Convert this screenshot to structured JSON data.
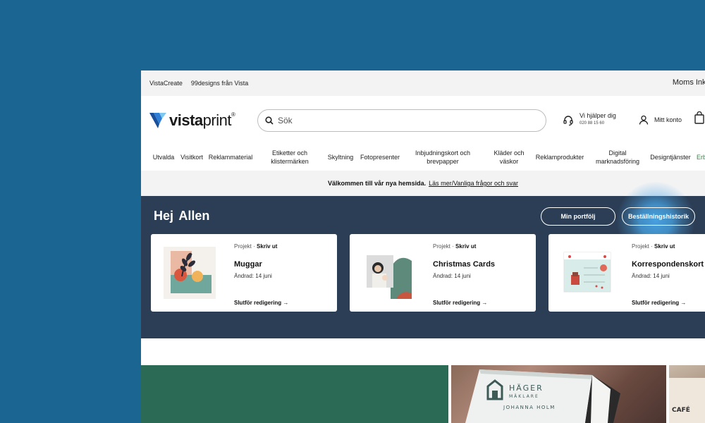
{
  "topbar": {
    "links": [
      "VistaCreate",
      "99designs från Vista"
    ],
    "right_text": "Moms Inkl"
  },
  "header": {
    "logo_text_a": "vista",
    "logo_text_b": "print",
    "logo_mark": "®",
    "search_placeholder": "Sök",
    "help_title": "Vi hjälper dig",
    "help_phone": "020 88 15 60",
    "account_label": "Mitt konto"
  },
  "nav": {
    "items": [
      "Utvalda",
      "Visitkort",
      "Reklammaterial",
      "Etiketter och klistermärken",
      "Skyltning",
      "Fotopresenter",
      "Inbjudningskort och brevpapper",
      "Kläder och väskor",
      "Reklamprodukter",
      "Digital marknadsföring",
      "Designtjänster",
      "Erb"
    ]
  },
  "banner": {
    "bold_text": "Välkommen till vår nya hemsida.",
    "link_text": "Läs mer/Vanliga frågor och svar"
  },
  "dashboard": {
    "greeting": "Hej  Allen",
    "portfolio_button": "Min portfölj",
    "orders_button": "Beställningshistorik",
    "cards": [
      {
        "type": "Projekt",
        "action": "Skriv ut",
        "title": "Muggar",
        "date": "Ändrad: 14 juni",
        "cta": "Slutför redigering"
      },
      {
        "type": "Projekt",
        "action": "Skriv ut",
        "title": "Christmas Cards",
        "date": "Ändrad: 14 juni",
        "cta": "Slutför redigering"
      },
      {
        "type": "Projekt",
        "action": "Skriv ut",
        "title": "Korrespondenskort",
        "date": "Ändrad: 14 juni",
        "cta": "Slutför redigering"
      }
    ]
  },
  "promo": {
    "card_company": "HÄGER",
    "card_sub": "MÄKLARE",
    "card_name": "JOHANNA HOLM",
    "cafe_text": "CAFÉ"
  },
  "colors": {
    "background": "#1a6591",
    "dashboard": "#2c3e55",
    "accent_blue": "#48a5e6",
    "promo_green": "#2b6b55"
  },
  "icons": {
    "cta_arrow": "→",
    "separator": "·"
  }
}
